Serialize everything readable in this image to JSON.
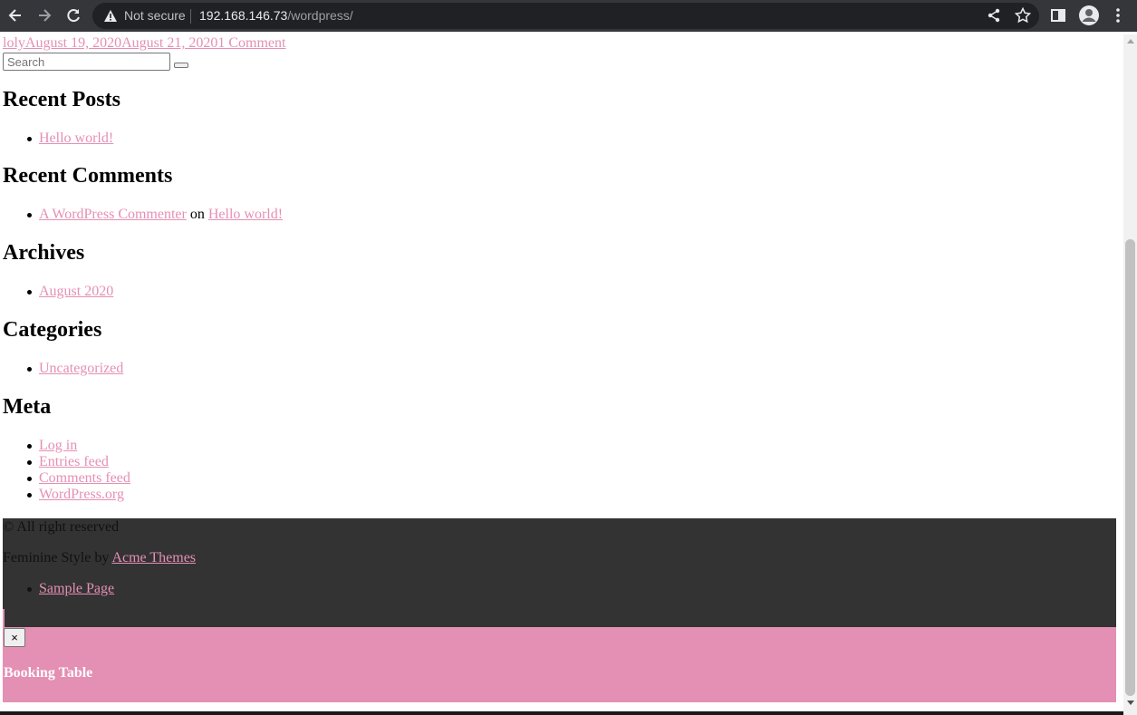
{
  "browser": {
    "security_label": "Not secure",
    "url_host": "192.168.146.73",
    "url_path": "/wordpress/"
  },
  "post_meta": {
    "author": "loly",
    "date_published": "August 19, 2020",
    "date_updated": "August 21, 2020",
    "comments": "1 Comment"
  },
  "search": {
    "placeholder": "Search"
  },
  "widgets": {
    "recent_posts": {
      "title": "Recent Posts",
      "items": [
        "Hello world!"
      ]
    },
    "recent_comments": {
      "title": "Recent Comments",
      "author": "A WordPress Commenter",
      "connector": "on",
      "post": "Hello world!"
    },
    "archives": {
      "title": "Archives",
      "items": [
        "August 2020"
      ]
    },
    "categories": {
      "title": "Categories",
      "items": [
        "Uncategorized"
      ]
    },
    "meta": {
      "title": "Meta",
      "items": [
        "Log in",
        "Entries feed",
        "Comments feed",
        "WordPress.org"
      ]
    }
  },
  "footer": {
    "copyright": "© All right reserved",
    "credit_prefix": "Feminine Style by ",
    "credit_link": "Acme Themes",
    "menu": [
      "Sample Page"
    ]
  },
  "booking": {
    "close_label": "×",
    "title": "Booking Table"
  },
  "colors": {
    "link": "#e58fb4",
    "footer_bg": "#333333",
    "booking_bg": "#e48fb4"
  }
}
